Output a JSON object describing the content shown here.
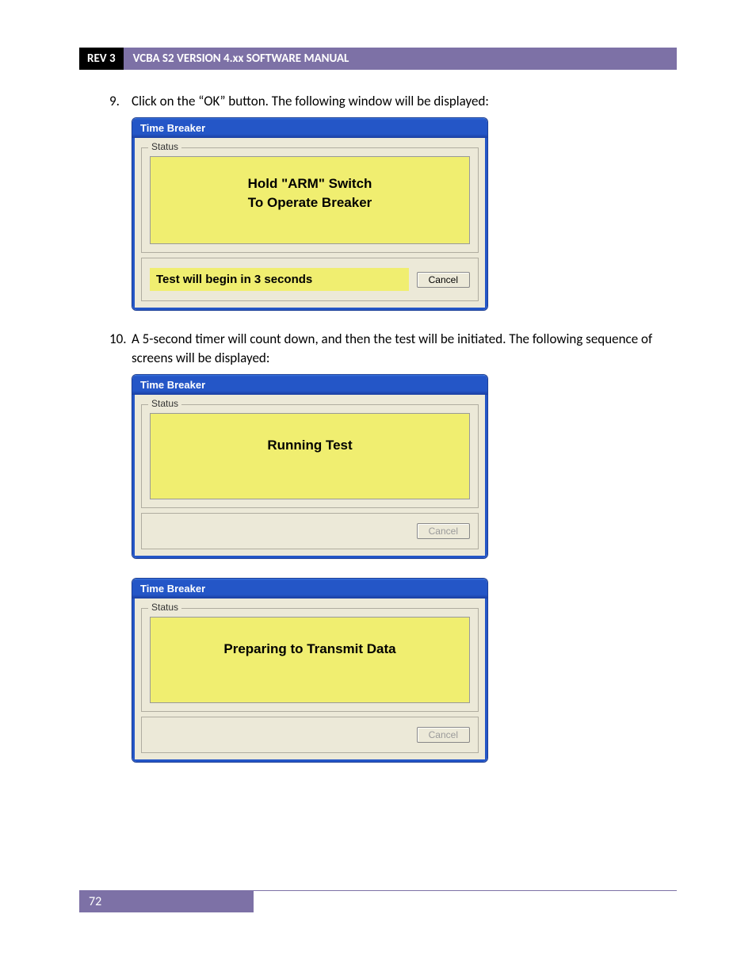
{
  "header": {
    "rev": "REV 3",
    "title": "VCBA S2 VERSION 4.xx SOFTWARE MANUAL"
  },
  "steps": [
    {
      "num": "9.",
      "text": "Click on the “OK” button. The following window will be displayed:"
    },
    {
      "num": "10.",
      "text": "A 5-second timer will count down, and then the test will be initiated. The following sequence of screens will be displayed:"
    }
  ],
  "dialogs": {
    "d1": {
      "title": "Time Breaker",
      "legend": "Status",
      "line1": "Hold \"ARM\" Switch",
      "line2": "To Operate Breaker",
      "countdown": "Test will begin in 3 seconds",
      "cancel": "Cancel"
    },
    "d2": {
      "title": "Time Breaker",
      "legend": "Status",
      "message": "Running Test",
      "cancel": "Cancel"
    },
    "d3": {
      "title": "Time Breaker",
      "legend": "Status",
      "message": "Preparing to Transmit Data",
      "cancel": "Cancel"
    }
  },
  "footer": {
    "page": "72"
  }
}
